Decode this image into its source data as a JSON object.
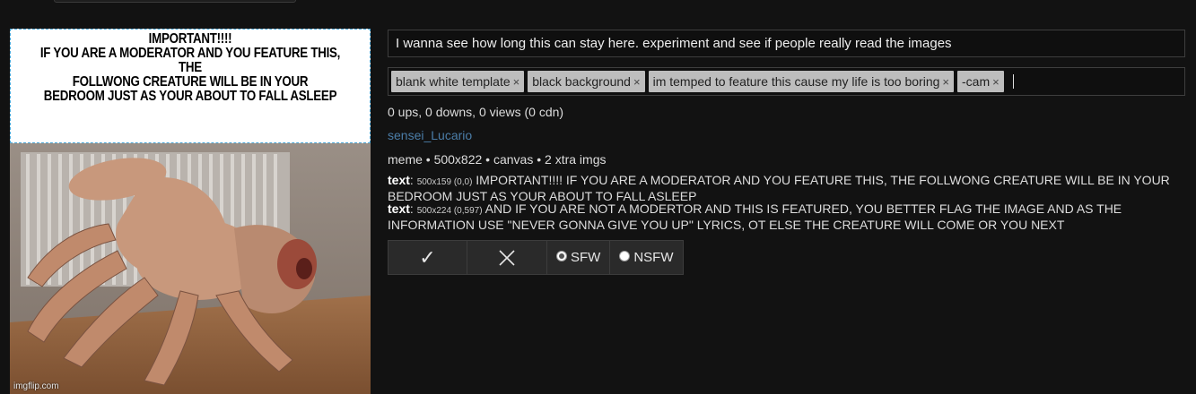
{
  "meme": {
    "top_text": "IMPORTANT!!!!\nIF YOU ARE A MODERATOR AND YOU FEATURE THIS, THE\nFOLLWONG CREATURE WILL BE IN YOUR\nBEDROOM JUST AS YOUR ABOUT TO FALL ASLEEP",
    "watermark": "imgflip.com"
  },
  "title_input": {
    "value": "I wanna see how long this can stay here. experiment and see if people really read the images"
  },
  "tags": [
    {
      "label": "blank white template",
      "remove": "×"
    },
    {
      "label": "black background",
      "remove": "×"
    },
    {
      "label": "im temped to feature this cause my life is too boring",
      "remove": "×"
    },
    {
      "label": "-cam",
      "remove": "×"
    }
  ],
  "stats": "0 ups, 0 downs, 0 views (0 cdn)",
  "username": "sensei_Lucario",
  "meta": "meme • 500x822 • canvas • 2 xtra imgs",
  "text_boxes": [
    {
      "label": "text",
      "colon": ":",
      "dims": "500x159 (0,0)",
      "content": "IMPORTANT!!!! IF YOU ARE A MODERATOR AND YOU FEATURE THIS, THE FOLLWONG CREATURE WILL BE IN YOUR BEDROOM JUST AS YOUR ABOUT TO FALL ASLEEP"
    },
    {
      "label": "text",
      "colon": ":",
      "dims": "500x224 (0,597)",
      "content": "AND IF YOU ARE NOT A MODERTOR AND THIS IS FEATURED, YOU BETTER FLAG THE IMAGE AND AS THE INFORMATION USE \"NEVER GONNA GIVE YOU UP\" LYRICS, OT ELSE THE CREATURE WILL COME OR YOU NEXT"
    }
  ],
  "moderation": {
    "approve_icon": "✓",
    "disapprove_icon": "✕",
    "sfw_label": "SFW",
    "nsfw_label": "NSFW",
    "selected": "SFW"
  }
}
